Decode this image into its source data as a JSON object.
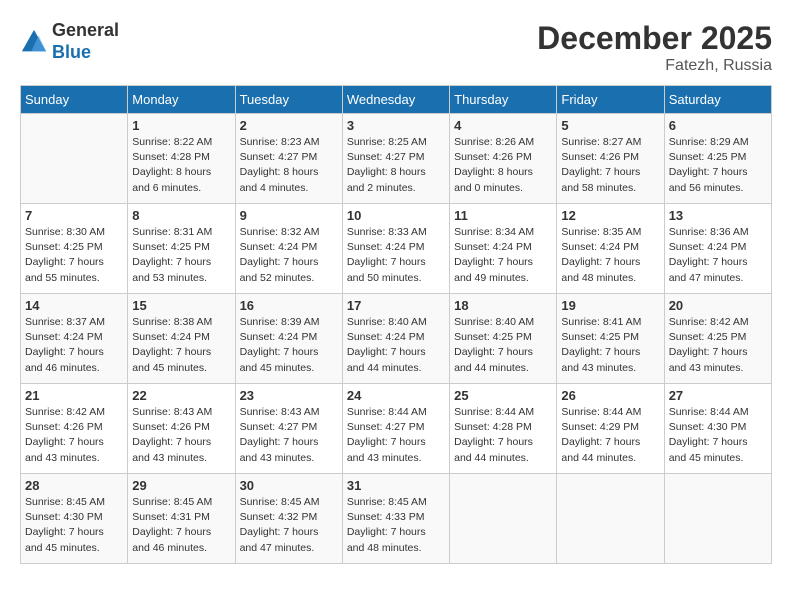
{
  "header": {
    "logo_line1": "General",
    "logo_line2": "Blue",
    "month": "December 2025",
    "location": "Fatezh, Russia"
  },
  "days_of_week": [
    "Sunday",
    "Monday",
    "Tuesday",
    "Wednesday",
    "Thursday",
    "Friday",
    "Saturday"
  ],
  "weeks": [
    [
      {
        "day": "",
        "info": ""
      },
      {
        "day": "1",
        "info": "Sunrise: 8:22 AM\nSunset: 4:28 PM\nDaylight: 8 hours\nand 6 minutes."
      },
      {
        "day": "2",
        "info": "Sunrise: 8:23 AM\nSunset: 4:27 PM\nDaylight: 8 hours\nand 4 minutes."
      },
      {
        "day": "3",
        "info": "Sunrise: 8:25 AM\nSunset: 4:27 PM\nDaylight: 8 hours\nand 2 minutes."
      },
      {
        "day": "4",
        "info": "Sunrise: 8:26 AM\nSunset: 4:26 PM\nDaylight: 8 hours\nand 0 minutes."
      },
      {
        "day": "5",
        "info": "Sunrise: 8:27 AM\nSunset: 4:26 PM\nDaylight: 7 hours\nand 58 minutes."
      },
      {
        "day": "6",
        "info": "Sunrise: 8:29 AM\nSunset: 4:25 PM\nDaylight: 7 hours\nand 56 minutes."
      }
    ],
    [
      {
        "day": "7",
        "info": "Sunrise: 8:30 AM\nSunset: 4:25 PM\nDaylight: 7 hours\nand 55 minutes."
      },
      {
        "day": "8",
        "info": "Sunrise: 8:31 AM\nSunset: 4:25 PM\nDaylight: 7 hours\nand 53 minutes."
      },
      {
        "day": "9",
        "info": "Sunrise: 8:32 AM\nSunset: 4:24 PM\nDaylight: 7 hours\nand 52 minutes."
      },
      {
        "day": "10",
        "info": "Sunrise: 8:33 AM\nSunset: 4:24 PM\nDaylight: 7 hours\nand 50 minutes."
      },
      {
        "day": "11",
        "info": "Sunrise: 8:34 AM\nSunset: 4:24 PM\nDaylight: 7 hours\nand 49 minutes."
      },
      {
        "day": "12",
        "info": "Sunrise: 8:35 AM\nSunset: 4:24 PM\nDaylight: 7 hours\nand 48 minutes."
      },
      {
        "day": "13",
        "info": "Sunrise: 8:36 AM\nSunset: 4:24 PM\nDaylight: 7 hours\nand 47 minutes."
      }
    ],
    [
      {
        "day": "14",
        "info": "Sunrise: 8:37 AM\nSunset: 4:24 PM\nDaylight: 7 hours\nand 46 minutes."
      },
      {
        "day": "15",
        "info": "Sunrise: 8:38 AM\nSunset: 4:24 PM\nDaylight: 7 hours\nand 45 minutes."
      },
      {
        "day": "16",
        "info": "Sunrise: 8:39 AM\nSunset: 4:24 PM\nDaylight: 7 hours\nand 45 minutes."
      },
      {
        "day": "17",
        "info": "Sunrise: 8:40 AM\nSunset: 4:24 PM\nDaylight: 7 hours\nand 44 minutes."
      },
      {
        "day": "18",
        "info": "Sunrise: 8:40 AM\nSunset: 4:25 PM\nDaylight: 7 hours\nand 44 minutes."
      },
      {
        "day": "19",
        "info": "Sunrise: 8:41 AM\nSunset: 4:25 PM\nDaylight: 7 hours\nand 43 minutes."
      },
      {
        "day": "20",
        "info": "Sunrise: 8:42 AM\nSunset: 4:25 PM\nDaylight: 7 hours\nand 43 minutes."
      }
    ],
    [
      {
        "day": "21",
        "info": "Sunrise: 8:42 AM\nSunset: 4:26 PM\nDaylight: 7 hours\nand 43 minutes."
      },
      {
        "day": "22",
        "info": "Sunrise: 8:43 AM\nSunset: 4:26 PM\nDaylight: 7 hours\nand 43 minutes."
      },
      {
        "day": "23",
        "info": "Sunrise: 8:43 AM\nSunset: 4:27 PM\nDaylight: 7 hours\nand 43 minutes."
      },
      {
        "day": "24",
        "info": "Sunrise: 8:44 AM\nSunset: 4:27 PM\nDaylight: 7 hours\nand 43 minutes."
      },
      {
        "day": "25",
        "info": "Sunrise: 8:44 AM\nSunset: 4:28 PM\nDaylight: 7 hours\nand 44 minutes."
      },
      {
        "day": "26",
        "info": "Sunrise: 8:44 AM\nSunset: 4:29 PM\nDaylight: 7 hours\nand 44 minutes."
      },
      {
        "day": "27",
        "info": "Sunrise: 8:44 AM\nSunset: 4:30 PM\nDaylight: 7 hours\nand 45 minutes."
      }
    ],
    [
      {
        "day": "28",
        "info": "Sunrise: 8:45 AM\nSunset: 4:30 PM\nDaylight: 7 hours\nand 45 minutes."
      },
      {
        "day": "29",
        "info": "Sunrise: 8:45 AM\nSunset: 4:31 PM\nDaylight: 7 hours\nand 46 minutes."
      },
      {
        "day": "30",
        "info": "Sunrise: 8:45 AM\nSunset: 4:32 PM\nDaylight: 7 hours\nand 47 minutes."
      },
      {
        "day": "31",
        "info": "Sunrise: 8:45 AM\nSunset: 4:33 PM\nDaylight: 7 hours\nand 48 minutes."
      },
      {
        "day": "",
        "info": ""
      },
      {
        "day": "",
        "info": ""
      },
      {
        "day": "",
        "info": ""
      }
    ]
  ]
}
